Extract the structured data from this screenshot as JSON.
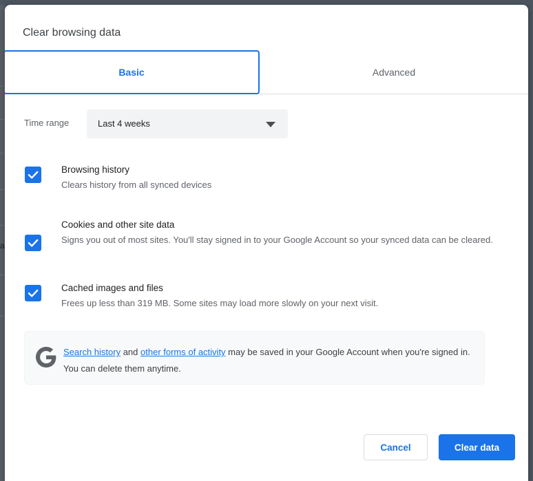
{
  "dialog": {
    "title": "Clear browsing data"
  },
  "tabs": [
    {
      "id": "basic",
      "label": "Basic",
      "selected": true
    },
    {
      "id": "advanced",
      "label": "Advanced",
      "selected": false
    }
  ],
  "time_range": {
    "label": "Time range",
    "selected": "Last 4 weeks"
  },
  "options": [
    {
      "id": "browsing-history",
      "title": "Browsing history",
      "subtitle": "Clears history from all synced devices",
      "checked": true
    },
    {
      "id": "cookies",
      "title": "Cookies and other site data",
      "subtitle": "Signs you out of most sites. You'll stay signed in to your Google Account so your synced data can be cleared.",
      "checked": true
    },
    {
      "id": "cached-images",
      "title": "Cached images and files",
      "subtitle": "Frees up less than 319 MB. Some sites may load more slowly on your next visit.",
      "checked": true
    }
  ],
  "info_card": {
    "icon": "google-g-icon",
    "link1": "Search history",
    "between": " and ",
    "link2": "other forms of activity",
    "tail": " may be saved in your Google Account when you're signed in. You can delete them anytime."
  },
  "footer": {
    "cancel_label": "Cancel",
    "confirm_label": "Clear data"
  },
  "colors": {
    "accent": "#1a73e8",
    "scrim": "#4d5560",
    "text_primary": "#202124",
    "text_secondary": "#5f6368",
    "card_bg": "#f8f9fa",
    "select_bg": "#f1f3f4"
  },
  "background_hint": {
    "char": "a"
  }
}
